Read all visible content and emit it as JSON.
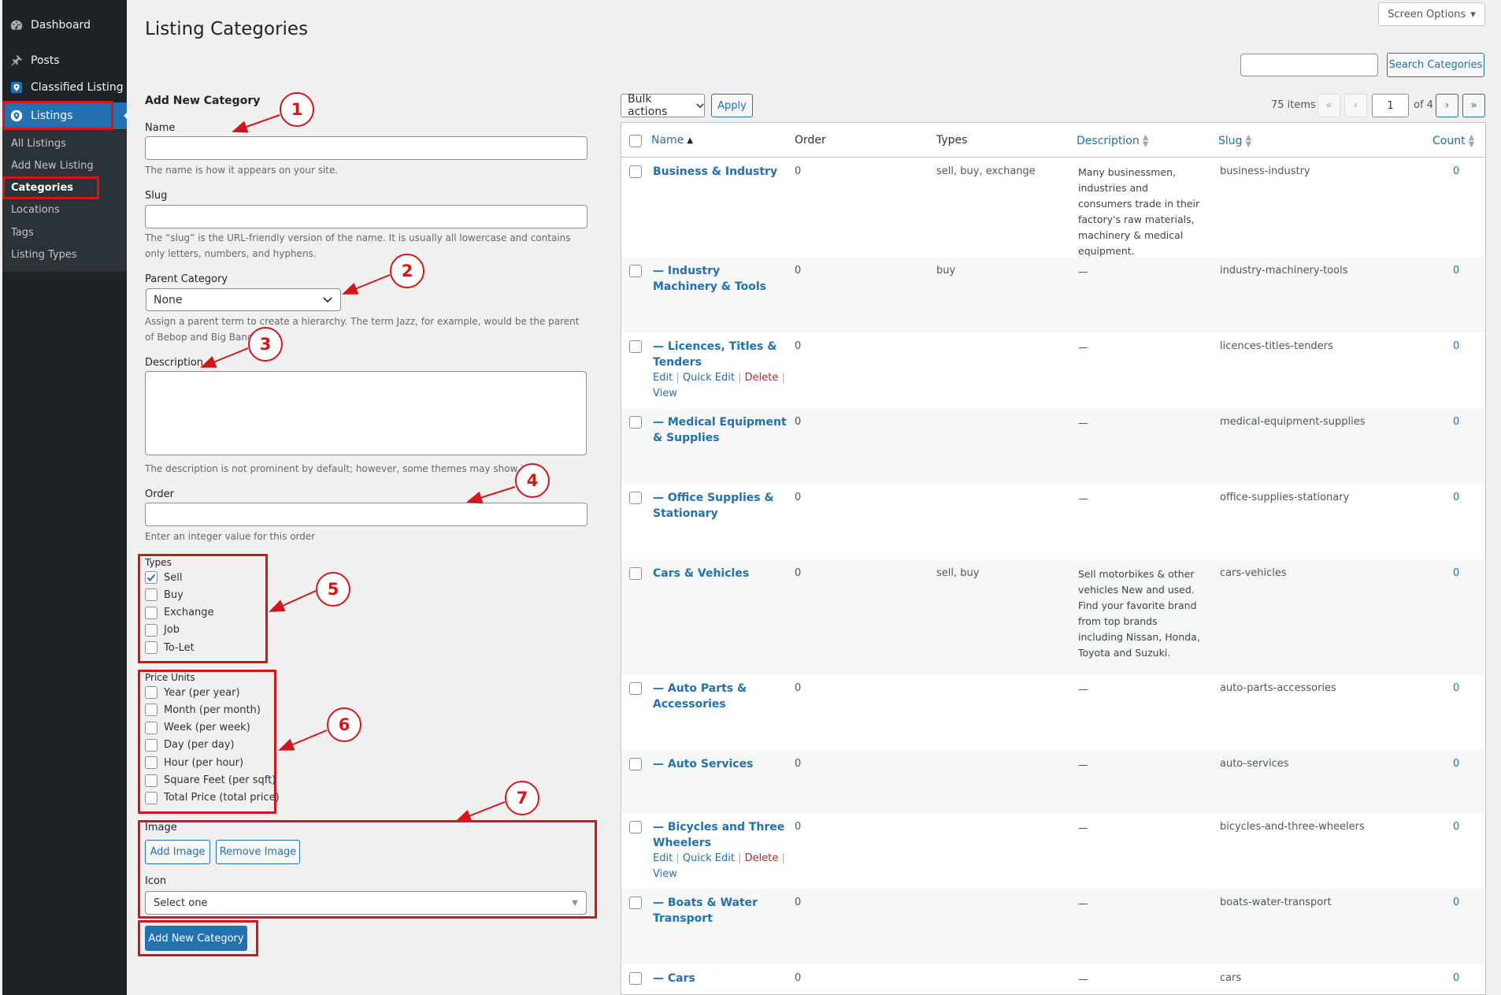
{
  "sidebar": {
    "dashboard": "Dashboard",
    "posts": "Posts",
    "classified": "Classified Listing",
    "listings": "Listings",
    "sub": [
      "All Listings",
      "Add New Listing",
      "Categories",
      "Locations",
      "Tags",
      "Listing Types"
    ]
  },
  "header": {
    "title": "Listing Categories",
    "screen_options": "Screen Options",
    "search_button": "Search Categories",
    "search_placeholder": ""
  },
  "form": {
    "heading": "Add New Category",
    "name_label": "Name",
    "name_help": "The name is how it appears on your site.",
    "slug_label": "Slug",
    "slug_help": "The “slug” is the URL-friendly version of the name. It is usually all lowercase and contains only letters, numbers, and hyphens.",
    "parent_label": "Parent Category",
    "parent_value": "None",
    "parent_help": "Assign a parent term to create a hierarchy. The term Jazz, for example, would be the parent of Bebop and Big Band.",
    "desc_label": "Description",
    "desc_help": "The description is not prominent by default; however, some themes may show it.",
    "order_label": "Order",
    "order_help": "Enter an integer value for this order",
    "types_label": "Types",
    "types": [
      {
        "label": "Sell",
        "checked": true
      },
      {
        "label": "Buy",
        "checked": false
      },
      {
        "label": "Exchange",
        "checked": false
      },
      {
        "label": "Job",
        "checked": false
      },
      {
        "label": "To-Let",
        "checked": false
      }
    ],
    "price_label": "Price Units",
    "price_units": [
      {
        "label": "Year (per year)",
        "checked": false
      },
      {
        "label": "Month (per month)",
        "checked": false
      },
      {
        "label": "Week (per week)",
        "checked": false
      },
      {
        "label": "Day (per day)",
        "checked": false
      },
      {
        "label": "Hour (per hour)",
        "checked": false
      },
      {
        "label": "Square Feet (per sqft)",
        "checked": false
      },
      {
        "label": "Total Price (total price)",
        "checked": false
      }
    ],
    "image_label": "Image",
    "add_image": "Add Image",
    "remove_image": "Remove Image",
    "icon_label": "Icon",
    "icon_value": "Select one",
    "submit": "Add New Category"
  },
  "callouts": [
    "1",
    "2",
    "3",
    "4",
    "5",
    "6",
    "7"
  ],
  "table": {
    "bulk_actions": "Bulk actions",
    "apply": "Apply",
    "items_count": "75 items",
    "page_current": "1",
    "of_pages": "of 4",
    "pager": {
      "first": "«",
      "prev": "‹",
      "next": "›",
      "last": "»"
    },
    "columns": {
      "name": "Name",
      "order": "Order",
      "types": "Types",
      "description": "Description",
      "slug": "Slug",
      "count": "Count"
    },
    "row_actions": {
      "edit": "Edit",
      "quick_edit": "Quick Edit",
      "delete": "Delete",
      "view": "View",
      "sep": "|"
    },
    "rows": [
      {
        "name": "Business & Industry",
        "order": "0",
        "types": "sell, buy, exchange",
        "description": "Many businessmen, industries and consumers trade in their factory's raw materials, machinery & medical equipment.",
        "slug": "business-industry",
        "count": "0",
        "actions": false
      },
      {
        "name": "— Industry Machinery & Tools",
        "order": "0",
        "types": "buy",
        "description": "—",
        "slug": "industry-machinery-tools",
        "count": "0",
        "actions": false
      },
      {
        "name": "— Licences, Titles & Tenders",
        "order": "0",
        "types": "",
        "description": "—",
        "slug": "licences-titles-tenders",
        "count": "0",
        "actions": true
      },
      {
        "name": "— Medical Equipment & Supplies",
        "order": "0",
        "types": "",
        "description": "—",
        "slug": "medical-equipment-supplies",
        "count": "0",
        "actions": false
      },
      {
        "name": "— Office Supplies & Stationary",
        "order": "0",
        "types": "",
        "description": "—",
        "slug": "office-supplies-stationary",
        "count": "0",
        "actions": false
      },
      {
        "name": "Cars & Vehicles",
        "order": "0",
        "types": "sell, buy",
        "description": "Sell motorbikes & other vehicles New and used. Find your favorite brand from top brands including Nissan, Honda, Toyota and Suzuki.",
        "slug": "cars-vehicles",
        "count": "0",
        "actions": false
      },
      {
        "name": "— Auto Parts & Accessories",
        "order": "0",
        "types": "",
        "description": "—",
        "slug": "auto-parts-accessories",
        "count": "0",
        "actions": false
      },
      {
        "name": "— Auto Services",
        "order": "0",
        "types": "",
        "description": "—",
        "slug": "auto-services",
        "count": "0",
        "actions": false
      },
      {
        "name": "— Bicycles and Three Wheelers",
        "order": "0",
        "types": "",
        "description": "—",
        "slug": "bicycles-and-three-wheelers",
        "count": "0",
        "actions": true
      },
      {
        "name": "— Boats & Water Transport",
        "order": "0",
        "types": "",
        "description": "—",
        "slug": "boats-water-transport",
        "count": "0",
        "actions": false
      },
      {
        "name": "— Cars",
        "order": "0",
        "types": "",
        "description": "—",
        "slug": "cars",
        "count": "0",
        "actions": false
      }
    ]
  },
  "colors": {
    "accent": "#2271b1",
    "sidebar": "#1d2327",
    "highlight": "#d4161b",
    "delete": "#b32d2e"
  }
}
